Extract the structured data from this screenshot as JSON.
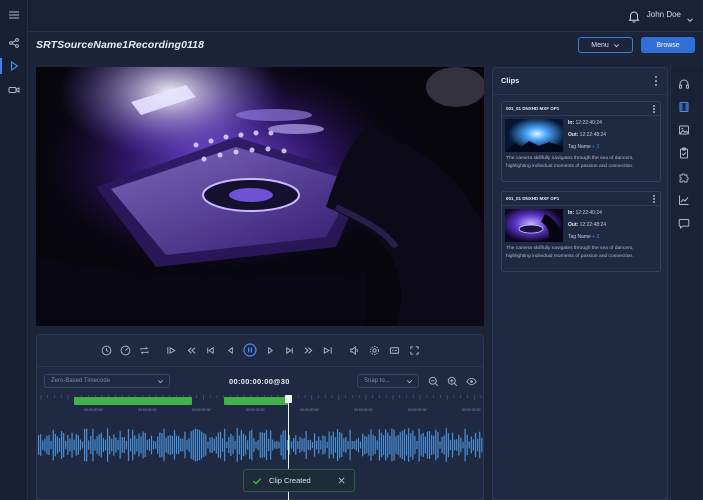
{
  "header": {
    "user_name": "John Doe",
    "recording_title": "SRTSourceName1Recording0118",
    "menu_label": "Menu",
    "browse_label": "Browse"
  },
  "timeline": {
    "timecode_mode": "Zero-Based Timecode",
    "current_timecode": "00:00:00:00@30",
    "snap_placeholder": "Snap to...",
    "ruler_labels": [
      "00:00:00:00",
      "00:00:00:00",
      "00:00:00:00",
      "00:00:00:00",
      "00:00:00:00",
      "00:00:00:00",
      "00:00:00:00",
      "00:00:00:00"
    ]
  },
  "toast": {
    "message": "Clip Created"
  },
  "clips": {
    "heading": "Clips",
    "items": [
      {
        "title": "001_01 DNXHD MXF OP1",
        "in_label": "In:",
        "in_time": "12:22:40:24",
        "out_label": "Out:",
        "out_time": "12:22:48:24",
        "tag_label": "Tag Name",
        "tag_count": "+ 3",
        "description": "The camera skillfully navigates through the sea of dancers, highlighting individual moments of passion and connection."
      },
      {
        "title": "001_01 DNXHD MXF OP1",
        "in_label": "In:",
        "in_time": "12:22:40:24",
        "out_label": "Out:",
        "out_time": "12:22:48:24",
        "tag_label": "Tag Name",
        "tag_count": "+ 3",
        "description": "The camera skillfully navigates through the sea of dancers, highlighting individual moments of passion and connection."
      }
    ]
  },
  "icons": {
    "left_rail": [
      "menu-icon",
      "share-icon",
      "play-icon",
      "camera-icon"
    ],
    "right_rail": [
      "headphones-icon",
      "film-icon",
      "image-icon",
      "clipboard-check-icon",
      "puzzle-icon",
      "chart-icon",
      "comment-icon"
    ]
  },
  "colors": {
    "accent": "#3b82f6",
    "clip_range": "#43b149",
    "waveform": "#4a90d9"
  }
}
